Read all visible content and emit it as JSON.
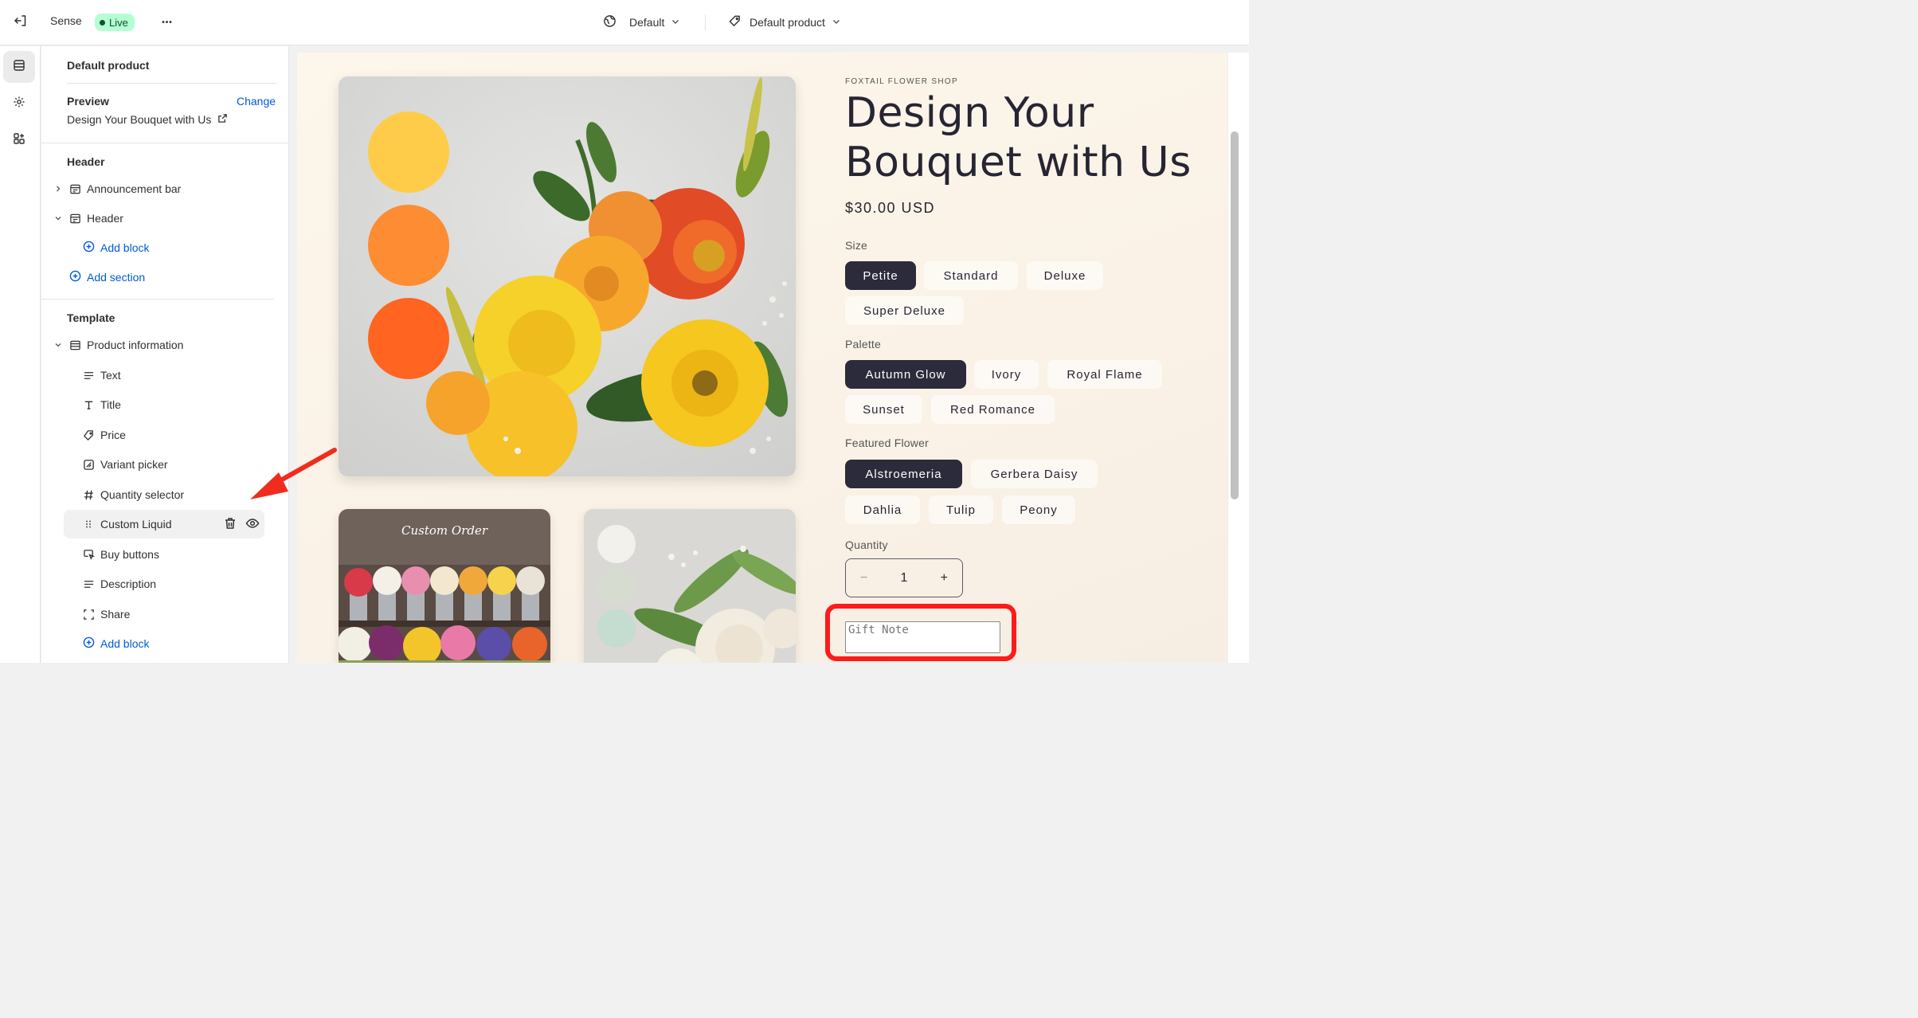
{
  "topbar": {
    "theme_name": "Sense",
    "status": "Live",
    "more_label": "•••",
    "locale_select": "Default",
    "template_select": "Default product"
  },
  "sidebar": {
    "title": "Default product",
    "preview_label": "Preview",
    "change_label": "Change",
    "preview_value": "Design Your Bouquet with Us",
    "header_group": "Header",
    "announcement_bar": "Announcement bar",
    "header_section": "Header",
    "add_block_header": "Add block",
    "add_section": "Add section",
    "template_group": "Template",
    "product_information": "Product information",
    "blocks": [
      "Text",
      "Title",
      "Price",
      "Variant picker",
      "Quantity selector",
      "Custom Liquid",
      "Buy buttons",
      "Description",
      "Share"
    ],
    "add_block_template": "Add block"
  },
  "product": {
    "vendor": "FOXTAIL FLOWER SHOP",
    "title": "Design Your Bouquet with Us",
    "price": "$30.00 USD",
    "thumb_caption": "Custom Order",
    "size_label": "Size",
    "sizes": [
      "Petite",
      "Standard",
      "Deluxe",
      "Super Deluxe"
    ],
    "palette_label": "Palette",
    "palettes": [
      "Autumn Glow",
      "Ivory",
      "Royal Flame",
      "Sunset",
      "Red Romance"
    ],
    "flower_label": "Featured Flower",
    "flowers": [
      "Alstroemeria",
      "Gerbera Daisy",
      "Dahlia",
      "Tulip",
      "Peony"
    ],
    "quantity_label": "Quantity",
    "quantity_value": "1",
    "qty_minus": "−",
    "qty_plus": "+",
    "gift_note_placeholder": "Gift Note"
  },
  "colors": {
    "accent": "#005bd3",
    "selected_pill": "#2b2b3b",
    "highlight": "#ff1a1a",
    "arrow": "#f02c1e",
    "swatch_yellow": "#ffcc4a",
    "swatch_orange": "#fd8c32",
    "swatch_red_orange": "#ff6420"
  }
}
